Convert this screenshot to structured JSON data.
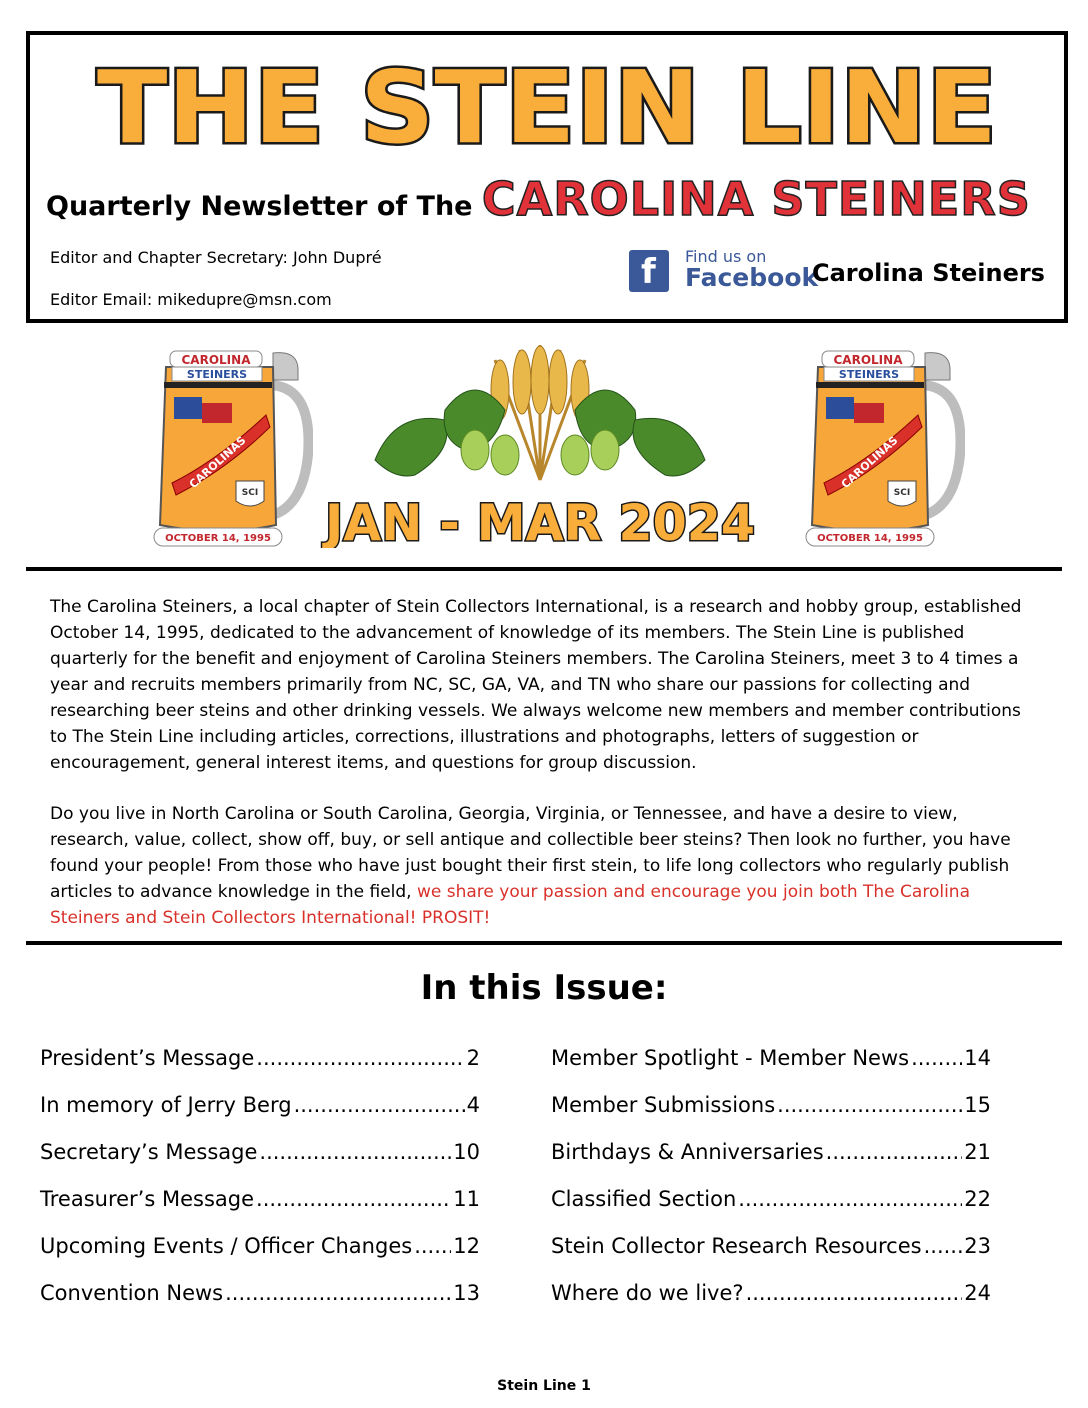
{
  "header": {
    "title": "THE STEIN LINE",
    "subtitle_lead": "Quarterly Newsletter of The",
    "subtitle_brand": "CAROLINA STEINERS",
    "editor": "Editor and Chapter Secretary:  John Dupré",
    "email": "Editor Email: mikedupre@msn.com",
    "facebook_find": "Find us on",
    "facebook_word": "Facebook",
    "facebook_icon": "f",
    "facebook_name": "Carolina Steiners",
    "colors": {
      "title_fill": "#f9ad3b",
      "brand_red": "#e03238",
      "facebook_blue": "#3b5998"
    }
  },
  "logo": {
    "top_text": "CAROLINA",
    "mid_text": "STEINERS",
    "ribbon_text": "CAROLINAS",
    "badge": "SCI",
    "date_text": "OCTOBER 14, 1995"
  },
  "issue_date": "JAN - MAR 2024",
  "intro": {
    "p1": "The Carolina Steiners, a local chapter of Stein Collectors International, is a research and hobby group, established October 14, 1995, dedicated to the advancement of knowledge of its members. The Stein Line is published quarterly for the benefit and enjoyment of Carolina Steiners members. The Carolina Steiners,  meet 3 to 4 times a year and recruits members primarily from NC, SC, GA, VA, and TN who share our passions for collecting and researching beer steins and other drinking vessels. We always welcome new members and member contributions to The Stein Line including articles, corrections, illustrations and photographs, letters of suggestion or encouragement, general interest items, and questions for group discussion.",
    "p2_black": "Do you live in North Carolina or South Carolina, Georgia, Virginia, or Tennessee, and have a desire to view, research, value, collect, show off, buy, or sell antique and collectible beer steins? Then look no further, you have found your people! From those who have just bought their first stein, to life long collectors who regularly publish articles to advance knowledge in the field, ",
    "p2_red": "we share your passion and encourage you join both The Carolina Steiners and Stein Collectors International!  PROSIT!"
  },
  "toc": {
    "heading": "In this Issue:",
    "left": [
      {
        "label": "President’s Message",
        "page": "2"
      },
      {
        "label": "In memory of Jerry Berg",
        "page": "4"
      },
      {
        "label": "Secretary’s Message",
        "page": "10"
      },
      {
        "label": "Treasurer’s Message",
        "page": "11"
      },
      {
        "label": "Upcoming Events / Officer Changes",
        "page": "12"
      },
      {
        "label": "Convention News",
        "page": "13"
      }
    ],
    "right": [
      {
        "label": "Member Spotlight - Member News",
        "page": "14"
      },
      {
        "label": "Member Submissions",
        "page": "15"
      },
      {
        "label": "Birthdays & Anniversaries ",
        "page": "21"
      },
      {
        "label": "Classified Section",
        "page": "22"
      },
      {
        "label": "Stein Collector Research Resources",
        "page": "23"
      },
      {
        "label": "Where do we live?",
        "page": "24"
      }
    ]
  },
  "footer": "Stein Line 1"
}
